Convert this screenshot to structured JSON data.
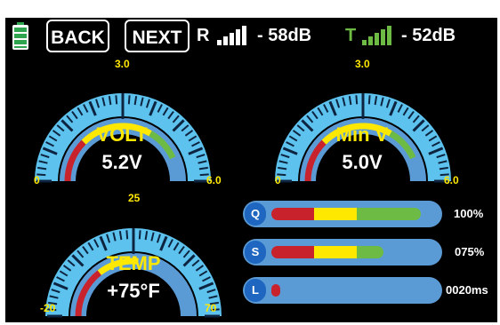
{
  "header": {
    "back_label": "BACK",
    "next_label": "NEXT",
    "receiver": {
      "label": "R",
      "value": "- 58dB",
      "color": "#ffffff"
    },
    "transmitter": {
      "label": "T",
      "value": "- 52dB",
      "color": "#6dbb45"
    }
  },
  "gauges": {
    "volt": {
      "title": "VOLT",
      "value": "5.2V",
      "min_label": "0",
      "mid_label": "3.0",
      "max_label": "6.0"
    },
    "minv": {
      "title": "Min V",
      "value": "5.0V",
      "min_label": "0",
      "mid_label": "3.0",
      "max_label": "6.0"
    },
    "temp": {
      "title": "TEMP",
      "value": "+75°F",
      "min_label": "-20",
      "mid_label": "25",
      "max_label": "70"
    }
  },
  "bars": [
    {
      "key": "Q",
      "value_text": "100%",
      "level": 1.0,
      "segments": [
        "#c8232c",
        "#ffe800",
        "#6dbb45"
      ]
    },
    {
      "key": "S",
      "value_text": "075%",
      "level": 0.75,
      "segments": [
        "#c8232c",
        "#ffe800",
        "#6dbb45"
      ]
    },
    {
      "key": "L",
      "value_text": "0020ms",
      "level": 0.06,
      "segments": [
        "#c8232c"
      ]
    }
  ],
  "colors": {
    "gauge_outer": "#5dc3ee",
    "gauge_ticks": "#0d2440",
    "gauge_inner": "#5b9bd5",
    "red": "#c8232c",
    "yellow": "#ffe800",
    "green": "#6dbb45",
    "battery": "#2ea44f"
  }
}
